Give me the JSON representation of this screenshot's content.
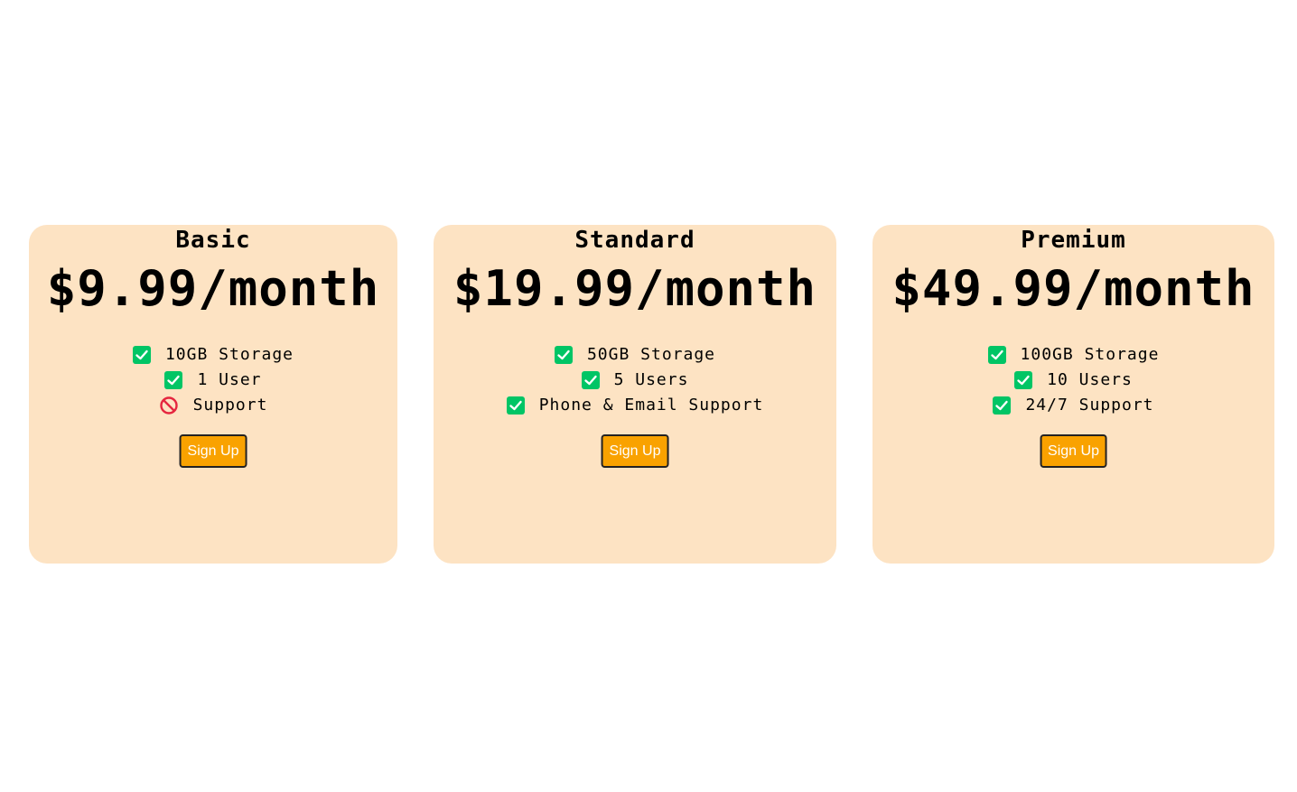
{
  "colors": {
    "card_background": "#fde3c3",
    "button_background": "#f9a200",
    "check": "#00c565",
    "ban": "#e5263f"
  },
  "plans": [
    {
      "name": "Basic",
      "price": "$9.99/month",
      "features": [
        {
          "icon": "check-icon",
          "text": "10GB Storage"
        },
        {
          "icon": "check-icon",
          "text": "1 User"
        },
        {
          "icon": "ban-icon",
          "text": "Support"
        }
      ],
      "button_label": "Sign Up"
    },
    {
      "name": "Standard",
      "price": "$19.99/month",
      "features": [
        {
          "icon": "check-icon",
          "text": "50GB Storage"
        },
        {
          "icon": "check-icon",
          "text": "5 Users"
        },
        {
          "icon": "check-icon",
          "text": "Phone & Email Support"
        }
      ],
      "button_label": "Sign Up"
    },
    {
      "name": "Premium",
      "price": "$49.99/month",
      "features": [
        {
          "icon": "check-icon",
          "text": "100GB Storage"
        },
        {
          "icon": "check-icon",
          "text": "10 Users"
        },
        {
          "icon": "check-icon",
          "text": "24/7 Support"
        }
      ],
      "button_label": "Sign Up"
    }
  ]
}
